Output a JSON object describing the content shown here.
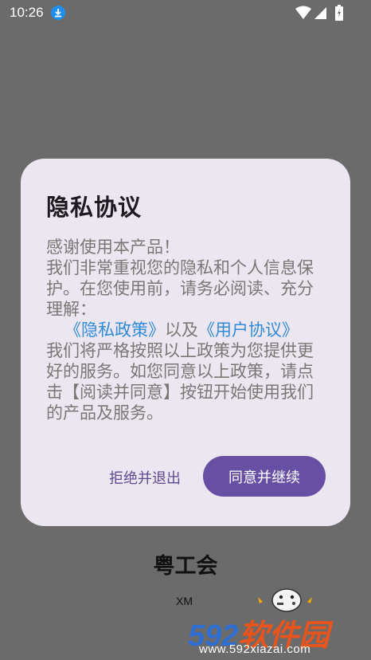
{
  "status_bar": {
    "time": "10:26",
    "icons": [
      "download-icon",
      "wifi-icon",
      "signal-icon",
      "battery-icon"
    ]
  },
  "dialog": {
    "title": "隐私协议",
    "body_lines": [
      "感谢使用本产品！",
      "我们非常重视您的隐私和个人信息保护。在您使用前，请务必阅读、充分理解："
    ],
    "privacy_link": "《隐私政策》",
    "and_text": "以及",
    "user_link": "《用户协议》",
    "closing": "我们将严格按照以上政策为您提供更好的服务。如您同意以上政策，请点击【阅读并同意】按钮开始使用我们的产品及服务。",
    "reject_label": "拒绝并退出",
    "agree_label": "同意并继续",
    "colors": {
      "accent": "#6750a4",
      "link": "#2f8bd8",
      "surface": "#ece6f1"
    }
  },
  "background_app": {
    "title": "粤工会",
    "xm_label": "XM"
  },
  "watermark": {
    "brand_num": "592",
    "brand_cn": "软件园",
    "url": "www.592xiazai.com"
  }
}
